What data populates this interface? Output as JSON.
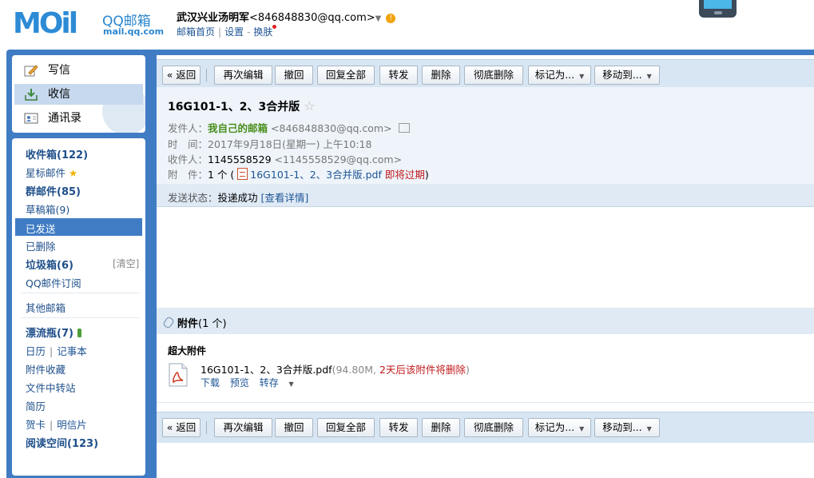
{
  "header": {
    "logo_text": "MOil",
    "logo_qq": "QQ邮箱",
    "logo_url": "mail.qq.com",
    "user_name": "武汉兴业汤明军",
    "user_email": "<846848830@qq.com>",
    "caret": "▼",
    "warn_icon": "!",
    "links": [
      "邮箱首页",
      "设置",
      "换肤"
    ],
    "sep": "|",
    "dash": "-"
  },
  "sidebar": {
    "top_items": [
      {
        "label": "写信",
        "icon": "compose-icon"
      },
      {
        "label": "收信",
        "icon": "inbox-download-icon"
      },
      {
        "label": "通讯录",
        "icon": "contacts-icon"
      }
    ],
    "folders": {
      "inbox": "收件箱(122)",
      "starred": "星标邮件",
      "star": "★",
      "group": "群邮件(85)",
      "drafts": "草稿箱(9)",
      "sent": "已发送",
      "deleted": "已删除",
      "spam": "垃圾箱(6)",
      "spam_clear": "[清空]",
      "subscriptions": "QQ邮件订阅",
      "other": "其他邮箱",
      "bottle": "漂流瓶(7)",
      "calendar": "日历",
      "notes": "记事本",
      "attach_fav": "附件收藏",
      "file_transfer": "文件中转站",
      "resume": "简历",
      "greeting": "贺卡",
      "postcard": "明信片",
      "reading": "阅读空间(123)",
      "sep": "|"
    }
  },
  "toolbar": {
    "back": "« 返回",
    "reedit": "再次编辑",
    "recall": "撤回",
    "reply_all": "回复全部",
    "forward": "转发",
    "delete": "删除",
    "delete_perm": "彻底删除",
    "mark_as": "标记为...",
    "move_to": "移动到...",
    "dd": "▼"
  },
  "mail": {
    "subject": "16G101-1、2、3合并版",
    "star": "☆",
    "from_label": "发件人：",
    "from_name": "我自己的邮箱",
    "from_email": "<846848830@qq.com>",
    "time_label": "时　间：",
    "time": "2017年9月18日(星期一) 上午10:18",
    "to_label": "收件人：",
    "to_name": "1145558529",
    "to_email": "<1145558529@qq.com>",
    "att_label": "附　件：",
    "att_count": "1 个 (",
    "att_name": "16G101-1、2、3合并版.pdf",
    "att_expire": "即将过期",
    "att_close": ")",
    "status_label": "发送状态：",
    "status_value": "投递成功",
    "status_link": "[查看详情]"
  },
  "attachments": {
    "title": "附件",
    "count": "(1 个)",
    "big_label": "超大附件",
    "file_name": "16G101-1、2、3合并版.pdf",
    "file_size": "(94.80M, ",
    "file_warn": "2天后该附件将删除",
    "file_close": ")",
    "download": "下载",
    "preview": "预览",
    "save": "转存",
    "dd": "▼"
  }
}
